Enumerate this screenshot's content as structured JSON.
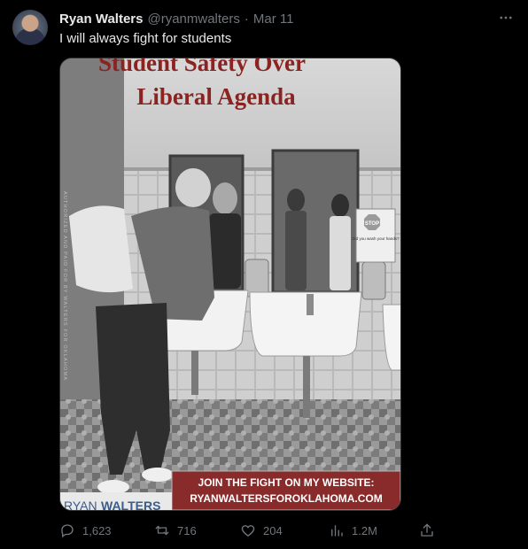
{
  "tweet": {
    "author_name": "Ryan Walters",
    "handle": "@ryanmwalters",
    "separator": "·",
    "date": "Mar 11",
    "text": "I will always fight for students"
  },
  "media": {
    "headline_line1": "Student Safety Over",
    "headline_line2": "Liberal Agenda",
    "stop_sign": "STOP",
    "stop_caption": "Did you wash your hands?",
    "cta_line1": "JOIN THE FIGHT ON MY WEBSITE:",
    "cta_line2": "RYANWALTERSFOROKLAHOMA.COM",
    "logo_first": "RYAN",
    "logo_second": "WALTERS",
    "side_text": "AUTHORIZED AND PAID FOR BY WALTERS FOR OKLAHOMA"
  },
  "actions": {
    "replies": "1,623",
    "retweets": "716",
    "likes": "204",
    "views": "1.2M"
  },
  "icons": [
    "more-icon",
    "reply-icon",
    "retweet-icon",
    "like-icon",
    "views-icon",
    "share-icon"
  ]
}
